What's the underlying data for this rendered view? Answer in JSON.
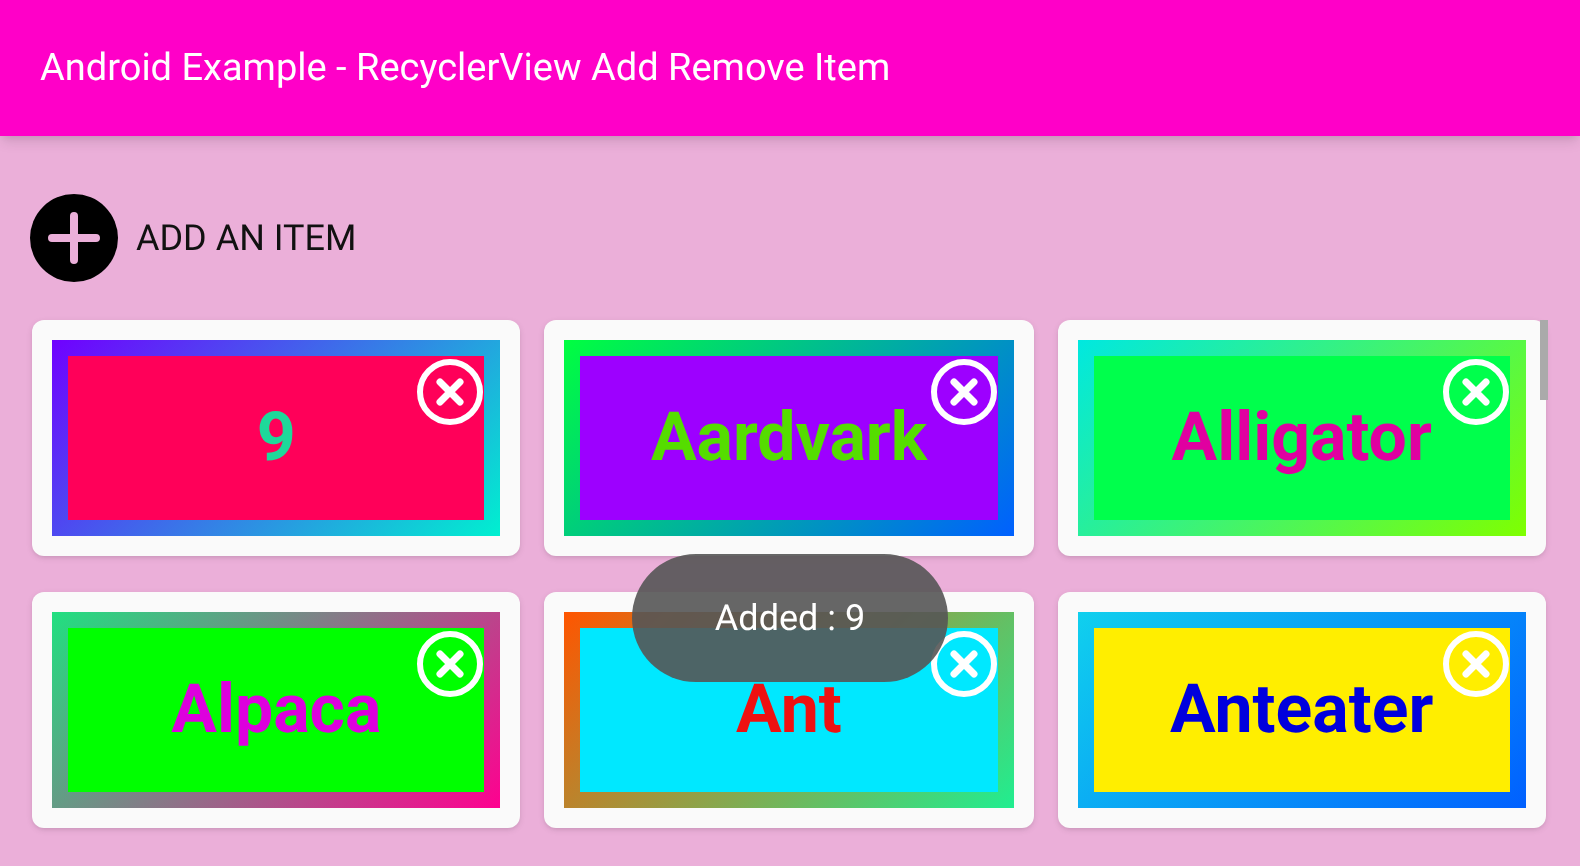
{
  "app_bar": {
    "title": "Android Example - RecyclerView Add Remove Item"
  },
  "add_button": {
    "label": "ADD AN ITEM"
  },
  "items": [
    {
      "color": "#ff0059",
      "label": {
        "text": "9",
        "color": "#1ed99a"
      },
      "frame": [
        {
          "color": "#7000ff"
        },
        {
          "color": "#00f0d0"
        }
      ]
    },
    {
      "color": "#9d00ff",
      "label": {
        "text": "Aardvark",
        "color": "#55dd00"
      },
      "frame": [
        {
          "color": "#00ff40"
        },
        {
          "color": "#0060ff"
        }
      ]
    },
    {
      "color": "#00ff4c",
      "label": {
        "text": "Alligator",
        "color": "#e000a0"
      },
      "frame": [
        {
          "color": "#00e8e0"
        },
        {
          "color": "#7fff00"
        }
      ]
    },
    {
      "color": "#00ff00",
      "label": {
        "text": "Alpaca",
        "color": "#dd00dd"
      },
      "frame": [
        {
          "color": "#20e080"
        },
        {
          "color": "#ff0090"
        }
      ]
    },
    {
      "color": "#00e8ff",
      "label": {
        "text": "Ant",
        "color": "#ee1111"
      },
      "frame": [
        {
          "color": "#ff5500"
        },
        {
          "color": "#20ee90"
        }
      ]
    },
    {
      "color": "#ffee00",
      "label": {
        "text": "Anteater",
        "color": "#0000dd"
      },
      "frame": [
        {
          "color": "#10d0ee"
        },
        {
          "color": "#0060ff"
        }
      ]
    }
  ],
  "toast": {
    "text": "Added : 9"
  }
}
